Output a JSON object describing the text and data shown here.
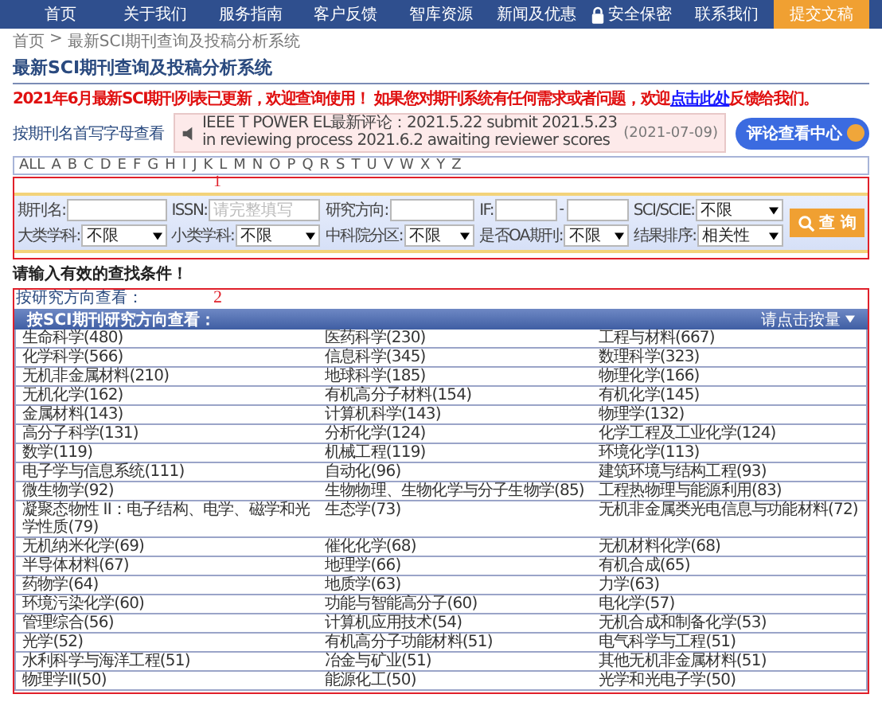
{
  "nav": [
    {
      "label": "首页",
      "kind": "link"
    },
    {
      "label": "关于我们",
      "kind": "link"
    },
    {
      "label": "服务指南",
      "kind": "link"
    },
    {
      "label": "客户反馈",
      "kind": "link"
    },
    {
      "label": "智库资源",
      "kind": "link"
    },
    {
      "label": "新闻及优惠",
      "kind": "link"
    },
    {
      "label": "安全保密",
      "kind": "locked"
    },
    {
      "label": "联系我们",
      "kind": "link"
    },
    {
      "label": "提交文稿",
      "kind": "cta"
    }
  ],
  "breadcrumb": [
    "首页",
    ">",
    "最新SCI期刊查询及投稿分析系统"
  ],
  "page_title": "最新SCI期刊查询及投稿分析系统",
  "notice": {
    "before": "2021年6月最新SCI期刊列表已更新，欢迎查询使用！ 如果您对期刊系统有任何需求或者问题，欢迎",
    "link": "点击此处",
    "after": "反馈给我们。"
  },
  "letter_label": "按期刊名首写字母查看",
  "ticker": {
    "text": "IEEE T POWER EL最新评论：2021.5.22 submit 2021.5.23 in reviewing process 2021.6.2 awaiting reviewer scores",
    "date": "(2021-07-09)"
  },
  "review_button": "评论查看中心",
  "letters": [
    "ALL",
    "A",
    "B",
    "C",
    "D",
    "E",
    "F",
    "G",
    "H",
    "I",
    "J",
    "K",
    "L",
    "M",
    "N",
    "O",
    "P",
    "Q",
    "R",
    "S",
    "T",
    "U",
    "V",
    "W",
    "X",
    "Y",
    "Z"
  ],
  "annotations": [
    "1",
    "2"
  ],
  "search": {
    "fields": [
      {
        "label": "期刊名:",
        "kind": "text"
      },
      {
        "label": "ISSN:",
        "kind": "text",
        "placeholder": "请完整填写"
      },
      {
        "label": "研究方向:",
        "kind": "text"
      },
      {
        "label": "IF:",
        "kind": "range",
        "separator": "-"
      },
      {
        "label": "SCI/SCIE:",
        "kind": "select",
        "value": "不限"
      },
      {
        "label": "大类学科:",
        "kind": "select",
        "value": "不限"
      },
      {
        "label": "小类学科:",
        "kind": "select",
        "value": "不限"
      },
      {
        "label": "中科院分区:",
        "kind": "select",
        "value": "不限"
      },
      {
        "label": "是否OA期刊:",
        "kind": "select",
        "value": "不限"
      },
      {
        "label": "结果排序:",
        "kind": "select",
        "value": "相关性"
      }
    ],
    "button": "查 询"
  },
  "hint": "请输入有效的查找条件！",
  "direction_label": "按研究方向查看：",
  "direction_table": {
    "title": "按SCI期刊研究方向查看：",
    "sort": "请点击按量",
    "rows": [
      [
        "生命科学(480)",
        "医药科学(230)",
        "工程与材料(667)"
      ],
      [
        "化学科学(566)",
        "信息科学(345)",
        "数理科学(323)"
      ],
      [
        "无机非金属材料(210)",
        "地球科学(185)",
        "物理化学(166)"
      ],
      [
        "无机化学(162)",
        "有机高分子材料(154)",
        "有机化学(145)"
      ],
      [
        "金属材料(143)",
        "计算机科学(143)",
        "物理学(132)"
      ],
      [
        "高分子科学(131)",
        "分析化学(124)",
        "化学工程及工业化学(124)"
      ],
      [
        "数学(119)",
        "机械工程(119)",
        "环境化学(113)"
      ],
      [
        "电子学与信息系统(111)",
        "自动化(96)",
        "建筑环境与结构工程(93)"
      ],
      [
        "微生物学(92)",
        "生物物理、生物化学与分子生物学(85)",
        "工程热物理与能源利用(83)"
      ],
      [
        "凝聚态物性 II：电子结构、电学、磁学和光学性质(79)",
        "生态学(73)",
        "无机非金属类光电信息与功能材料(72)"
      ],
      [
        "无机纳米化学(69)",
        "催化化学(68)",
        "无机材料化学(68)"
      ],
      [
        "半导体材料(67)",
        "地理学(66)",
        "有机合成(65)"
      ],
      [
        "药物学(64)",
        "地质学(63)",
        "力学(63)"
      ],
      [
        "环境污染化学(60)",
        "功能与智能高分子(60)",
        "电化学(57)"
      ],
      [
        "管理综合(56)",
        "计算机应用技术(54)",
        "无机合成和制备化学(53)"
      ],
      [
        "光学(52)",
        "有机高分子功能材料(51)",
        "电气科学与工程(51)"
      ],
      [
        "水利科学与海洋工程(51)",
        "冶金与矿业(51)",
        "其他无机非金属材料(51)"
      ],
      [
        "物理学II(50)",
        "能源化工(50)",
        "光学和光电子学(50)"
      ]
    ]
  }
}
